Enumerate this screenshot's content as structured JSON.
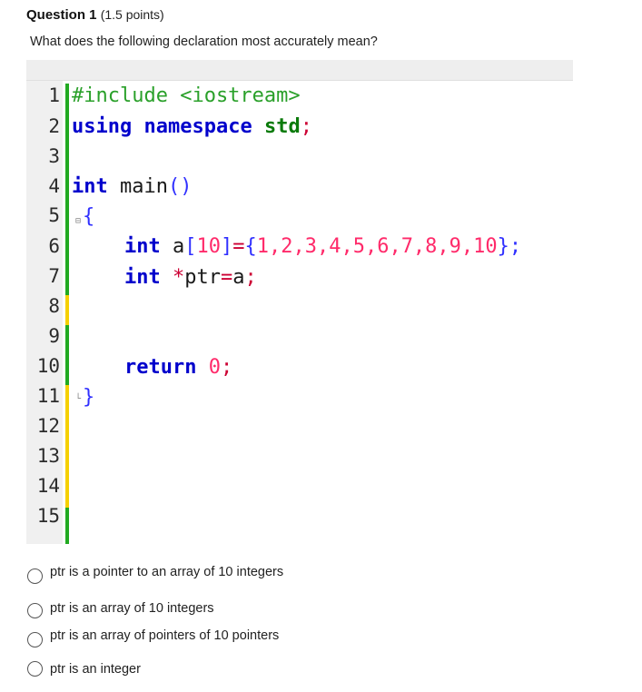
{
  "question": {
    "number_label": "Question 1",
    "points_label": "(1.5 points)",
    "prompt": "What does the following declaration most accurately mean?"
  },
  "code": {
    "line_numbers": [
      "1",
      "2",
      "3",
      "4",
      "5",
      "6",
      "7",
      "8",
      "9",
      "10",
      "11",
      "12",
      "13",
      "14",
      "15"
    ],
    "line1_pp": "#include <iostream>",
    "line2_kw1": "using",
    "line2_kw2": "namespace",
    "line2_kw3": "std",
    "line2_semi": ";",
    "line4_kw": "int",
    "line4_rest": " main",
    "line4_parens": "()",
    "line5_brace": "{",
    "line6_kw": "int",
    "line6_name": " a",
    "line6_b1": "[",
    "line6_n10": "10",
    "line6_b2": "]",
    "line6_eq": "=",
    "line6_ob": "{",
    "line6_vals": "1,2,3,4,5,6,7,8,9,10",
    "line6_cb": "};",
    "line7_kw": "int",
    "line7_star": " *",
    "line7_ptr": "ptr",
    "line7_eq": "=",
    "line7_a": "a",
    "line7_semi": ";",
    "line10_kw": "return",
    "line10_zero": " 0",
    "line10_semi": ";",
    "line11_brace": "}"
  },
  "options": [
    {
      "label": "ptr is a pointer to an array of 10 integers"
    },
    {
      "label": "ptr is an array of 10 integers"
    },
    {
      "label": "ptr is an array of pointers of 10 pointers"
    },
    {
      "label": "ptr is an integer"
    }
  ],
  "colors": {
    "change_green": "#22aa22",
    "change_yellow": "#f5d000"
  }
}
